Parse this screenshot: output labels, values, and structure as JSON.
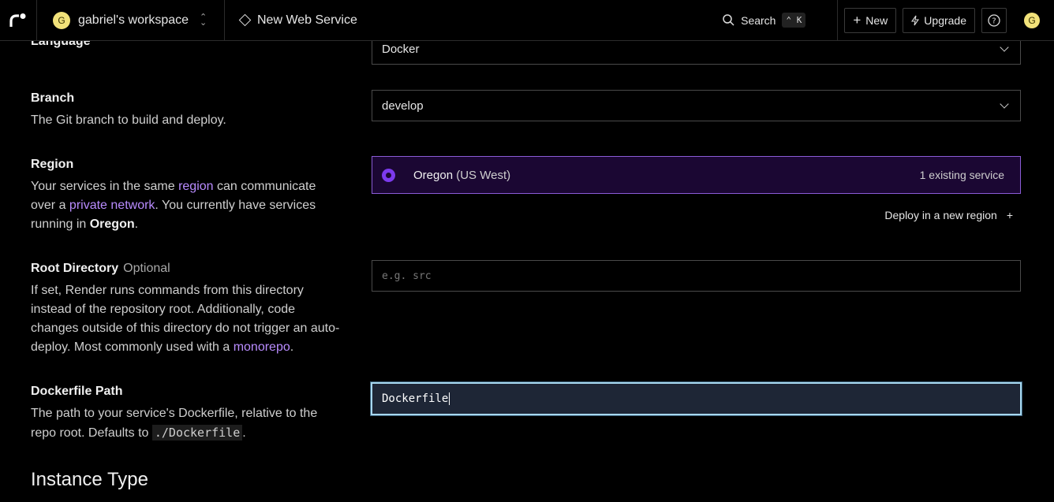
{
  "topbar": {
    "workspace_initial": "G",
    "workspace_name": "gabriel's workspace",
    "page_title": "New Web Service",
    "search_label": "Search",
    "search_kbd": "⌃ K",
    "new_label": "New",
    "upgrade_label": "Upgrade",
    "user_initial": "G"
  },
  "language": {
    "label": "Language",
    "value": "Docker"
  },
  "branch": {
    "label": "Branch",
    "description": "The Git branch to build and deploy.",
    "value": "develop"
  },
  "region": {
    "label": "Region",
    "desc_part1": "Your services in the same ",
    "desc_link1": "region",
    "desc_part2": " can communicate over a ",
    "desc_link2": "private network",
    "desc_part3": ". You currently have services running in ",
    "desc_bold": "Oregon",
    "desc_part4": ".",
    "selected_name": "Oregon",
    "selected_sub": "(US West)",
    "existing": "1 existing service",
    "deploy_new": "Deploy in a new region",
    "deploy_new_icon": "+"
  },
  "root_directory": {
    "label": "Root Directory",
    "optional": "Optional",
    "desc_part1": "If set, Render runs commands from this directory instead of the repository root. Additionally, code changes outside of this directory do not trigger an auto-deploy. Most commonly used with a ",
    "desc_link": "monorepo",
    "desc_part2": ".",
    "placeholder": "e.g. src"
  },
  "dockerfile_path": {
    "label": "Dockerfile Path",
    "desc_part1": "The path to your service's Dockerfile, relative to the repo root. Defaults to ",
    "desc_code": "./Dockerfile",
    "desc_part2": ".",
    "value": "Dockerfile"
  },
  "instance_type": {
    "title": "Instance Type"
  },
  "colors": {
    "accent": "#7c3aed",
    "link": "#b98cff",
    "focus": "#a7d8f0"
  }
}
